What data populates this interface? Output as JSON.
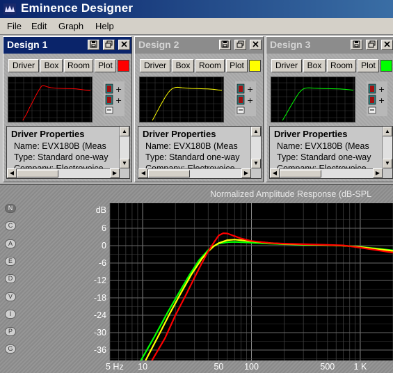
{
  "window": {
    "title": "Eminence Designer",
    "icon": "eminence-logo-icon"
  },
  "menu": [
    "File",
    "Edit",
    "Graph",
    "Help"
  ],
  "toolbar_labels": {
    "driver": "Driver",
    "box": "Box",
    "room": "Room",
    "plot": "Plot"
  },
  "panel_buttons": {
    "save": "save-icon",
    "restore": "restore-icon",
    "close": "close-icon"
  },
  "designs": [
    {
      "title": "Design 1",
      "active": true,
      "color": "#ff0000",
      "props_heading": "Driver Properties",
      "props_lines": [
        "Name: EVX180B (Meas",
        "Type: Standard one-way",
        "Company: Electrovoice"
      ]
    },
    {
      "title": "Design 2",
      "active": false,
      "color": "#ffff00",
      "props_heading": "Driver Properties",
      "props_lines": [
        "Name: EVX180B (Meas",
        "Type: Standard one-way",
        "Company: Electrovoice"
      ]
    },
    {
      "title": "Design 3",
      "active": false,
      "color": "#00ff00",
      "props_heading": "Driver Properties",
      "props_lines": [
        "Name: EVX180B (Meas",
        "Type: Standard one-way",
        "Company: Electrovoice"
      ]
    }
  ],
  "graph_toolbar": [
    "N",
    "C",
    "A",
    "E",
    "D",
    "V",
    "I",
    "P",
    "G"
  ],
  "chart_data": {
    "type": "line",
    "title": "Normalized Amplitude Response (dB-SPL",
    "ylabel": "dB",
    "xlabel": "",
    "x_scale": "log",
    "xlim": [
      5,
      2000
    ],
    "ylim": [
      -40,
      8
    ],
    "yticks": [
      6,
      0,
      -6,
      -12,
      -18,
      -24,
      -30,
      -36
    ],
    "xticks": [
      5,
      10,
      50,
      100,
      500,
      1000
    ],
    "xtick_labels": [
      "5 Hz",
      "10",
      "50",
      "100",
      "500",
      "1 K"
    ],
    "grid": true,
    "series": [
      {
        "color": "#ff0000",
        "x": [
          12,
          16,
          20,
          25,
          30,
          35,
          40,
          45,
          50,
          55,
          60,
          70,
          80,
          100,
          150,
          200,
          300,
          500,
          700,
          1000,
          1500,
          2000
        ],
        "y": [
          -40,
          -32,
          -24,
          -17,
          -11,
          -6,
          -2,
          1,
          3.5,
          4.3,
          4.2,
          3.3,
          2.5,
          1.6,
          0.9,
          0.7,
          0.5,
          0.3,
          0.1,
          -0.7,
          -1.7,
          -2.4
        ]
      },
      {
        "color": "#ffff00",
        "x": [
          10.5,
          14,
          18,
          22,
          28,
          35,
          40,
          45,
          50,
          60,
          70,
          80,
          100,
          150,
          200,
          300,
          500,
          700,
          1000,
          1500,
          2000
        ],
        "y": [
          -40,
          -31,
          -23,
          -17,
          -10,
          -4.5,
          -2,
          -0.2,
          0.9,
          1.9,
          2.1,
          1.9,
          1.5,
          0.9,
          0.6,
          0.4,
          0.2,
          0,
          -0.5,
          -1.3,
          -1.8
        ]
      },
      {
        "color": "#00ff00",
        "x": [
          9.5,
          13,
          17,
          21,
          27,
          33,
          40,
          45,
          50,
          60,
          70,
          80,
          100,
          150,
          200,
          300,
          500,
          700,
          1000,
          1500,
          2000
        ],
        "y": [
          -40,
          -31,
          -23,
          -17,
          -10,
          -5,
          -1.5,
          -0.2,
          0.7,
          1.2,
          1.3,
          1.2,
          1.0,
          0.7,
          0.5,
          0.3,
          0.2,
          0,
          -0.4,
          -1.1,
          -1.6
        ]
      }
    ]
  }
}
